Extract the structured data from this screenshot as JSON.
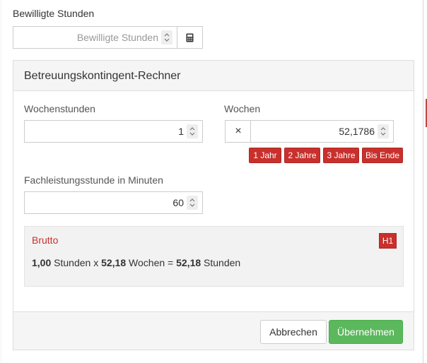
{
  "header": {
    "label": "Bewilligte Stunden",
    "input_placeholder": "Bewilligte Stunden",
    "calculator_icon": "calculator-icon"
  },
  "calculator": {
    "title": "Betreuungskontingent-Rechner",
    "wochenstunden": {
      "label": "Wochenstunden",
      "value": "1"
    },
    "wochen": {
      "label": "Wochen",
      "multiply_symbol": "×",
      "value": "52,1786",
      "presets": [
        "1 Jahr",
        "2 Jahre",
        "3 Jahre",
        "Bis Ende"
      ]
    },
    "minuten": {
      "label": "Fachleistungsstunde in Minuten",
      "value": "60"
    },
    "result": {
      "title": "Brutto",
      "badge": "H1",
      "hours": "1,00",
      "hours_unit": "Stunden",
      "times": "x",
      "weeks": "52,18",
      "weeks_unit": "Wochen",
      "equals": "=",
      "total": "52,18",
      "total_unit": "Stunden"
    },
    "footer": {
      "cancel_label": "Abbrechen",
      "apply_label": "Übernehmen"
    }
  },
  "colors": {
    "accent_red": "#c9302c",
    "success_green": "#5cb85c"
  }
}
